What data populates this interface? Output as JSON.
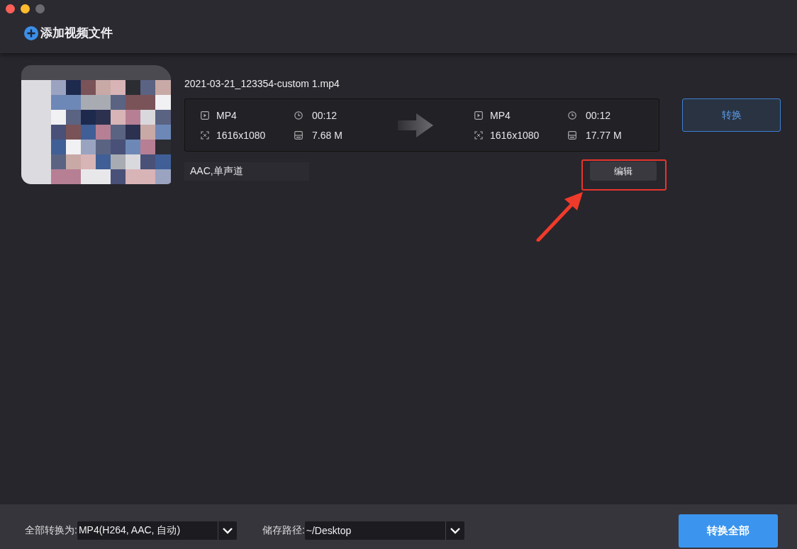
{
  "toolbar": {
    "add_button": "添加视频文件"
  },
  "file": {
    "name": "2021-03-21_123354-custom 1.mp4",
    "source": {
      "format": "MP4",
      "duration": "00:12",
      "resolution": "1616x1080",
      "size": "7.68 M"
    },
    "target": {
      "format": "MP4",
      "duration": "00:12",
      "resolution": "1616x1080",
      "size": "17.77 M"
    },
    "audio": "AAC,单声道",
    "edit_button": "编辑",
    "edit_highlighted": true,
    "convert_button": "转换"
  },
  "bottom_bar": {
    "format_label": "全部转换为:",
    "format_value": "MP4(H264, AAC, 自动)",
    "path_label": "储存路径:",
    "path_value": "~/Desktop",
    "convert_all_button": "转换全部"
  }
}
